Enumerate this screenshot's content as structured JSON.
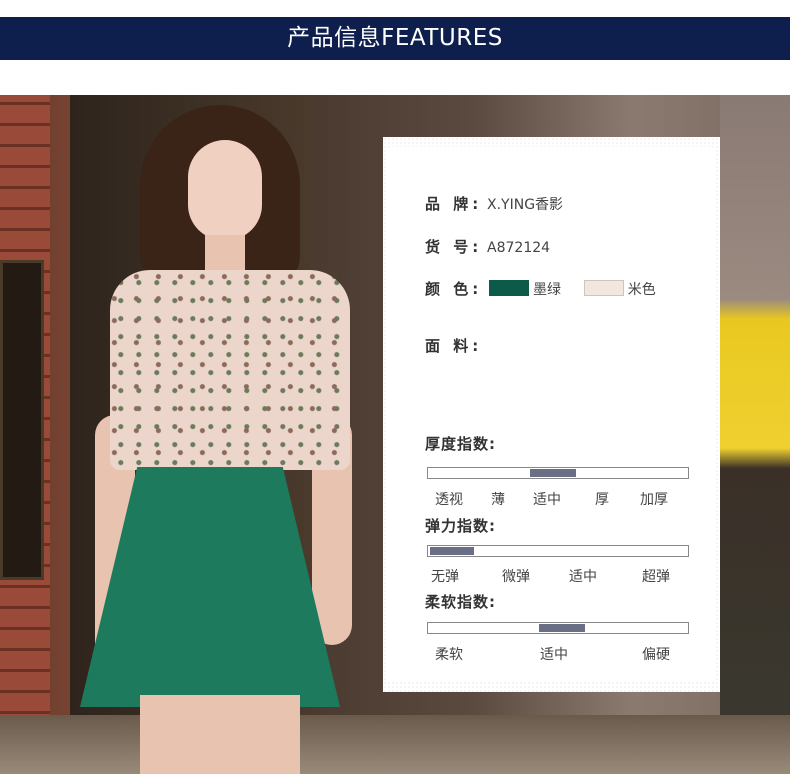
{
  "header": {
    "title": "产品信息FEATURES"
  },
  "product": {
    "brand": {
      "label": "品 牌:",
      "value": "X.YING香影"
    },
    "sku": {
      "label": "货 号:",
      "value": "A872124"
    },
    "color": {
      "label": "颜 色:",
      "options": [
        "墨绿",
        "米色"
      ],
      "swatches": [
        "#0c5a48",
        "#f1e7de"
      ]
    },
    "fabric": {
      "label": "面 料:"
    }
  },
  "indices": {
    "thickness": {
      "title": "厚度指数:",
      "labels": [
        "透视",
        "薄",
        "适中",
        "厚",
        "加厚"
      ],
      "selected": "适中"
    },
    "elasticity": {
      "title": "弹力指数:",
      "labels": [
        "无弹",
        "微弹",
        "适中",
        "超弹"
      ],
      "selected": "无弹"
    },
    "softness": {
      "title": "柔软指数:",
      "labels": [
        "柔软",
        "适中",
        "偏硬"
      ],
      "selected": "适中"
    }
  },
  "colors": {
    "banner": "#0e1f4d",
    "indicator": "#6a6f86"
  }
}
